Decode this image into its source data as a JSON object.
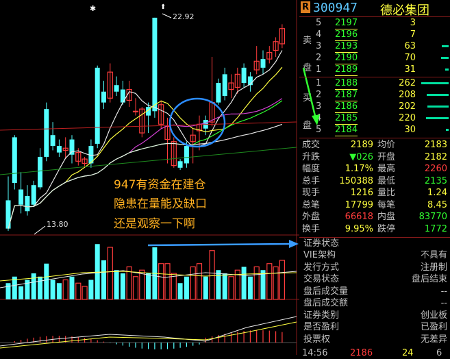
{
  "colors": {
    "up": "#ff3c3c",
    "down": "#54ffff",
    "text": "#c0c0c0",
    "yellow": "#ffff40",
    "green": "#30ff30",
    "blue": "#3a9cff",
    "white": "#e8e8e8",
    "magenta": "#d040d0"
  },
  "chart": {
    "high_label": "22.92",
    "low_label": "13.80",
    "annotation": [
      "947有资金在建仓",
      "隐患在量能及缺口",
      "还是观察一下啊"
    ]
  },
  "quote": {
    "code": "300947",
    "name": "德必集团",
    "badge": "R",
    "sell_side_label": [
      "卖",
      "盘"
    ],
    "buy_side_label": [
      "买",
      "盘"
    ],
    "asks": [
      {
        "level": "5",
        "price": "2197",
        "vol": "3"
      },
      {
        "level": "4",
        "price": "2196",
        "vol": "7"
      },
      {
        "level": "3",
        "price": "2193",
        "vol": "63"
      },
      {
        "level": "2",
        "price": "2190",
        "vol": "70"
      },
      {
        "level": "1",
        "price": "2189",
        "vol": "31"
      }
    ],
    "bids": [
      {
        "level": "1",
        "price": "2188",
        "vol": "262"
      },
      {
        "level": "2",
        "price": "2187",
        "vol": "208"
      },
      {
        "level": "3",
        "price": "2186",
        "vol": "202"
      },
      {
        "level": "4",
        "price": "2185",
        "vol": "220"
      },
      {
        "level": "5",
        "price": "2184",
        "vol": "30"
      }
    ],
    "bid_fill": [
      0.9,
      0.72,
      0.7,
      0.76,
      0.1
    ],
    "ask_fill": [
      0.0,
      0.0,
      0.22,
      0.25,
      0.11
    ],
    "stats": [
      {
        "l1": "成交",
        "v1": "2189",
        "l2": "均价",
        "v2": "2183"
      },
      {
        "l1": "升跌",
        "v1": "▼026",
        "l2": "开盘",
        "v2": "2182"
      },
      {
        "l1": "幅度",
        "v1": "1.17%",
        "l2": "最高",
        "v2": "2260"
      },
      {
        "l1": "总手",
        "v1": "150388",
        "l2": "最低",
        "v2": "2135"
      },
      {
        "l1": "现手",
        "v1": "1216",
        "l2": "量比",
        "v2": "1.24"
      },
      {
        "l1": "总笔",
        "v1": "17799",
        "l2": "每笔",
        "v2": "8.45"
      },
      {
        "l1": "外盘",
        "v1": "66618",
        "l2": "内盘",
        "v2": "83770"
      },
      {
        "l1": "换手",
        "v1": "9.95%",
        "l2": "跌停",
        "v2": "1772"
      }
    ],
    "info_title": "证券状态",
    "info": [
      {
        "k": "VIE架构",
        "v": "不具有"
      },
      {
        "k": "发行方式",
        "v": "注册制"
      },
      {
        "k": "交易状态",
        "v": "盘后结束"
      },
      {
        "k": "盘后成交量",
        "v": "--"
      },
      {
        "k": "盘后成交额",
        "v": "--"
      },
      {
        "k": "证券类别",
        "v": "创业板"
      },
      {
        "k": "是否盈利",
        "v": "已盈利"
      },
      {
        "k": "投票权",
        "v": "无差异"
      }
    ],
    "bottom_row": [
      "14:56",
      "2186",
      "24",
      "6"
    ]
  }
}
